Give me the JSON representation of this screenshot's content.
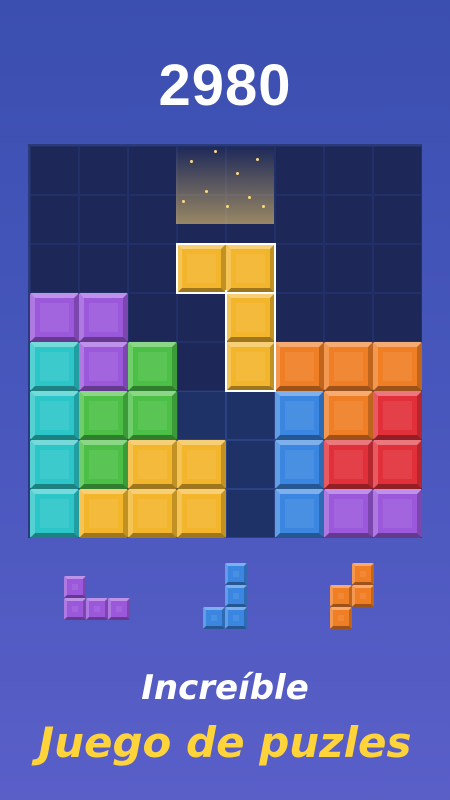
{
  "score": "2980",
  "colors": {
    "purple": "#9b58db",
    "cyan": "#2cc6c8",
    "green": "#4cc046",
    "yellow": "#f3b52c",
    "orange": "#f07e25",
    "red": "#e2303a",
    "blue": "#3a86e0"
  },
  "board": {
    "rows": 8,
    "cols": 8,
    "cells": [
      [
        null,
        null,
        null,
        null,
        null,
        null,
        null,
        null
      ],
      [
        null,
        null,
        null,
        null,
        null,
        null,
        null,
        null
      ],
      [
        null,
        null,
        null,
        "yellow",
        "yellow",
        null,
        null,
        null
      ],
      [
        "purple",
        "purple",
        null,
        null,
        "yellow",
        null,
        null,
        null
      ],
      [
        "cyan",
        "purple",
        "green",
        null,
        "yellow",
        "orange",
        "orange",
        "orange"
      ],
      [
        "cyan",
        "green",
        "green",
        null,
        null,
        "blue",
        "orange",
        "red"
      ],
      [
        "cyan",
        "green",
        "yellow",
        "yellow",
        null,
        "blue",
        "red",
        "red"
      ],
      [
        "cyan",
        "yellow",
        "yellow",
        "yellow",
        null,
        "blue",
        "purple",
        "purple"
      ]
    ],
    "highlight_cells": [
      [
        5,
        3
      ],
      [
        5,
        4
      ],
      [
        6,
        4
      ],
      [
        7,
        4
      ]
    ]
  },
  "tray": [
    {
      "color": "purple",
      "cells": [
        [
          0,
          0
        ],
        [
          1,
          0
        ],
        [
          1,
          1
        ],
        [
          1,
          2
        ]
      ]
    },
    {
      "color": "blue",
      "cells": [
        [
          0,
          1
        ],
        [
          1,
          1
        ],
        [
          2,
          0
        ],
        [
          2,
          1
        ]
      ]
    },
    {
      "color": "orange",
      "cells": [
        [
          0,
          1
        ],
        [
          1,
          0
        ],
        [
          1,
          1
        ],
        [
          2,
          0
        ]
      ]
    }
  ],
  "tagline": {
    "line1": "Increíble",
    "line2": "Juego de puzles"
  }
}
